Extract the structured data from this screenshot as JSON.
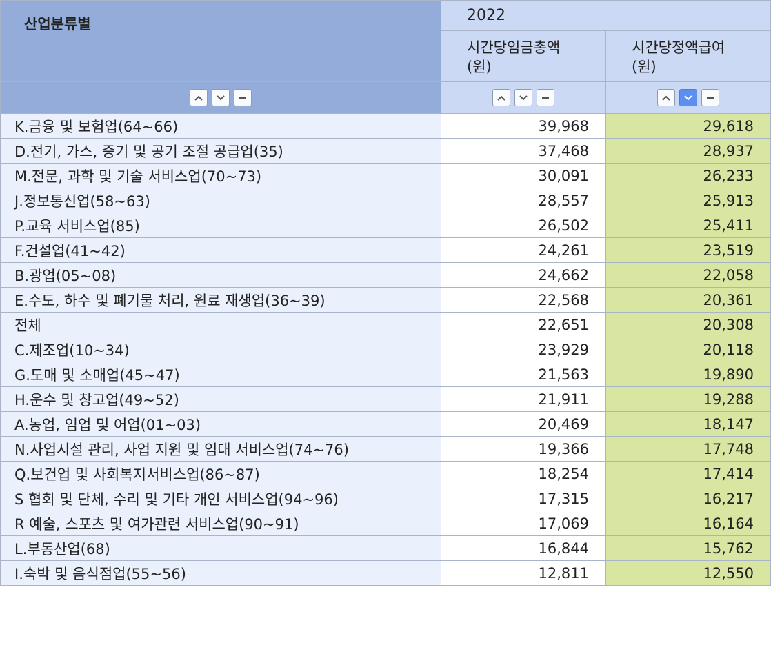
{
  "header": {
    "category_label": "산업분류별",
    "year": "2022",
    "columns": [
      "시간당임금총액\n(원)",
      "시간당정액급여\n(원)"
    ]
  },
  "sort_controls": {
    "icons": [
      "sort-ascending-icon",
      "sort-descending-icon",
      "sort-none-icon"
    ],
    "active": {
      "column": "시간당정액급여\n(원)",
      "button": "sort-descending"
    }
  },
  "colors": {
    "header_dark": "#93acd9",
    "header_light": "#ccd9f5",
    "category_cell": "#eaf0fc",
    "sorted_column": "#d8e6a2",
    "active_button": "#5b8ff0"
  },
  "rows": [
    {
      "category": "K.금융 및 보험업(64~66)",
      "total_wage": "39,968",
      "fixed_wage": "29,618"
    },
    {
      "category": "D.전기, 가스, 증기 및 공기 조절 공급업(35)",
      "total_wage": "37,468",
      "fixed_wage": "28,937"
    },
    {
      "category": "M.전문, 과학 및 기술 서비스업(70~73)",
      "total_wage": "30,091",
      "fixed_wage": "26,233"
    },
    {
      "category": "J.정보통신업(58~63)",
      "total_wage": "28,557",
      "fixed_wage": "25,913"
    },
    {
      "category": "P.교육 서비스업(85)",
      "total_wage": "26,502",
      "fixed_wage": "25,411"
    },
    {
      "category": "F.건설업(41~42)",
      "total_wage": "24,261",
      "fixed_wage": "23,519"
    },
    {
      "category": "B.광업(05~08)",
      "total_wage": "24,662",
      "fixed_wage": "22,058"
    },
    {
      "category": "E.수도, 하수 및 폐기물 처리, 원료 재생업(36~39)",
      "total_wage": "22,568",
      "fixed_wage": "20,361"
    },
    {
      "category": "전체",
      "total_wage": "22,651",
      "fixed_wage": "20,308"
    },
    {
      "category": "C.제조업(10~34)",
      "total_wage": "23,929",
      "fixed_wage": "20,118"
    },
    {
      "category": "G.도매 및 소매업(45~47)",
      "total_wage": "21,563",
      "fixed_wage": "19,890"
    },
    {
      "category": "H.운수 및 창고업(49~52)",
      "total_wage": "21,911",
      "fixed_wage": "19,288"
    },
    {
      "category": "A.농업, 임업 및 어업(01~03)",
      "total_wage": "20,469",
      "fixed_wage": "18,147"
    },
    {
      "category": "N.사업시설 관리, 사업 지원 및 임대 서비스업(74~76)",
      "total_wage": "19,366",
      "fixed_wage": "17,748"
    },
    {
      "category": "Q.보건업 및 사회복지서비스업(86~87)",
      "total_wage": "18,254",
      "fixed_wage": "17,414"
    },
    {
      "category": "S 협회 및 단체, 수리 및 기타 개인 서비스업(94~96)",
      "total_wage": "17,315",
      "fixed_wage": "16,217"
    },
    {
      "category": "R 예술, 스포츠 및 여가관련 서비스업(90~91)",
      "total_wage": "17,069",
      "fixed_wage": "16,164"
    },
    {
      "category": "L.부동산업(68)",
      "total_wage": "16,844",
      "fixed_wage": "15,762"
    },
    {
      "category": "I.숙박 및 음식점업(55~56)",
      "total_wage": "12,811",
      "fixed_wage": "12,550"
    }
  ]
}
